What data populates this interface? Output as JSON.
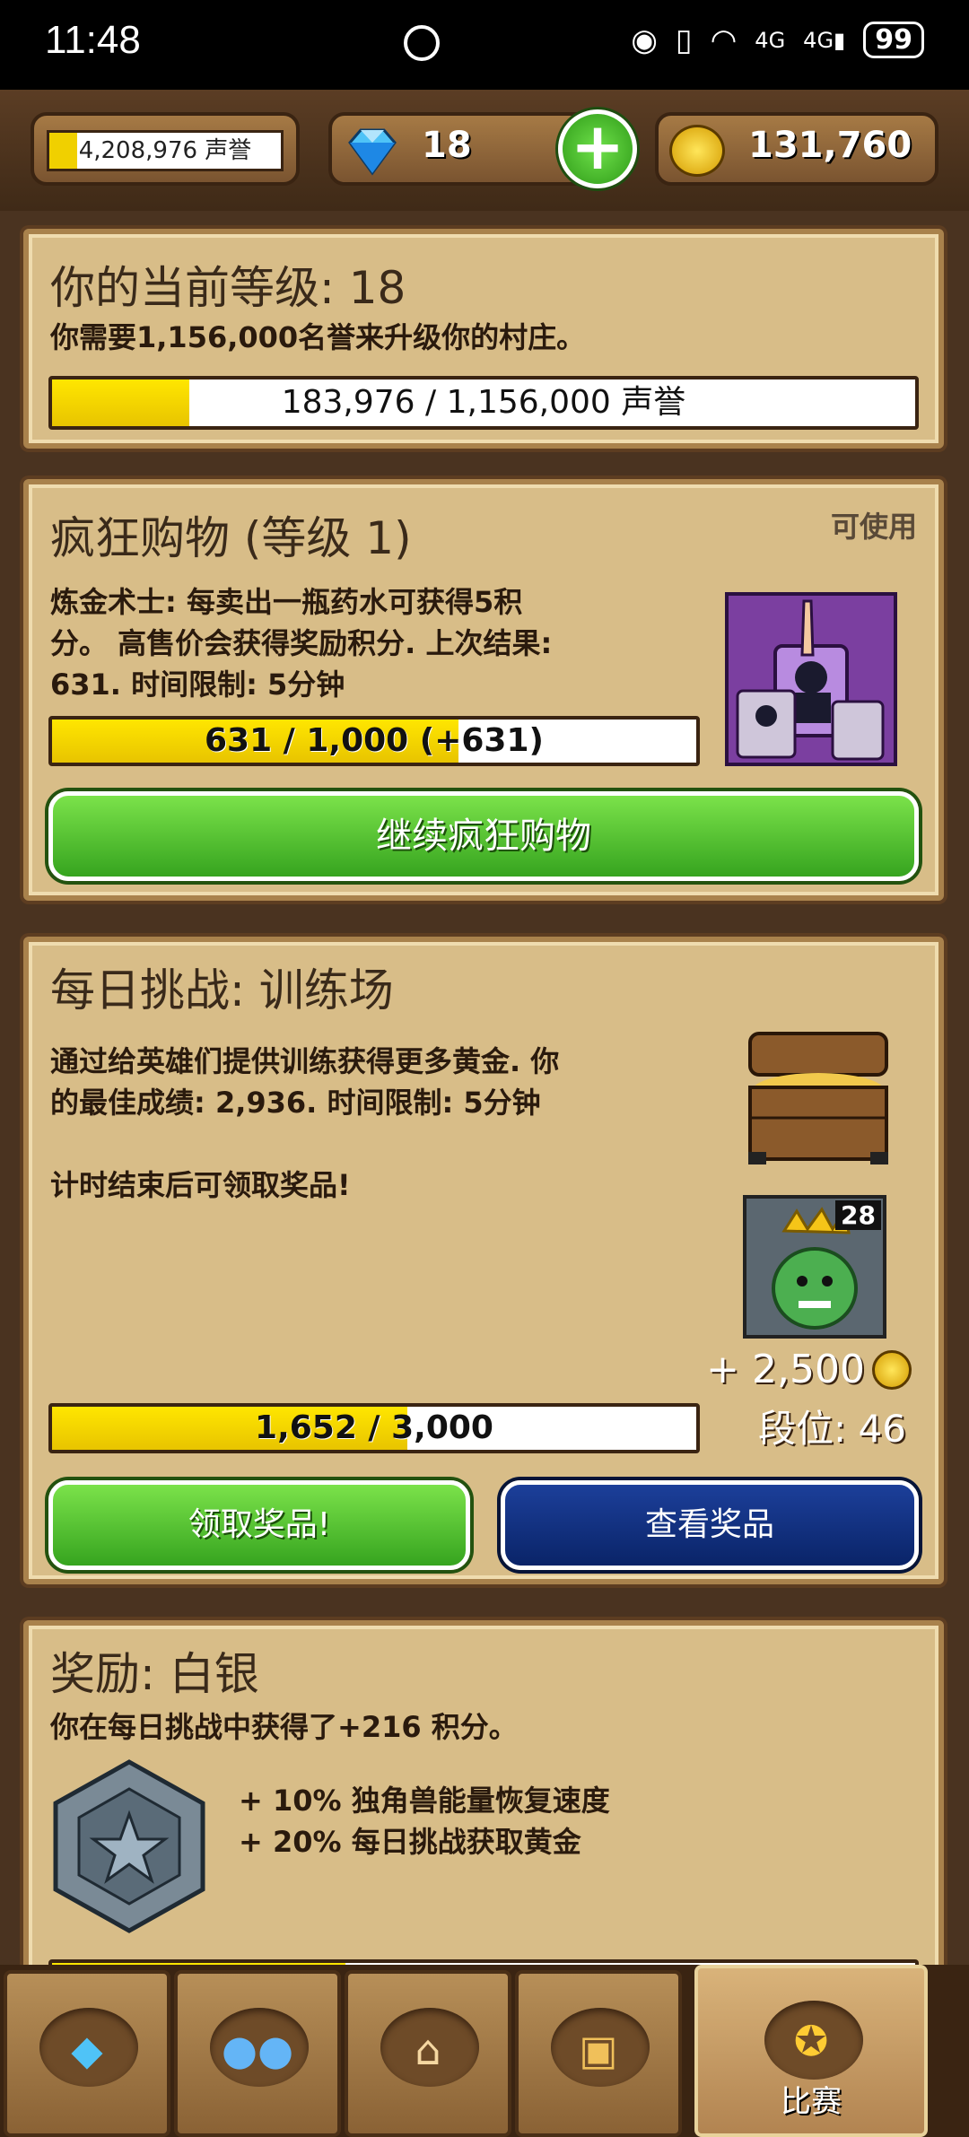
{
  "status_bar": {
    "time": "11:48",
    "network": "4G",
    "battery": "99"
  },
  "top_bar": {
    "fame_value": "4,208,976 声誉",
    "gems": "18",
    "gold": "131,760",
    "plus_label": "+"
  },
  "level_panel": {
    "title": "你的当前等级: 18",
    "description": "你需要1,156,000名誉来升级你的村庄。",
    "progress_label": "183,976 / 1,156,000 声誉",
    "progress_fraction": 0.159
  },
  "shopping_panel": {
    "title": "疯狂购物 (等级 1)",
    "status": "可使用",
    "description": [
      "炼金术士: 每卖出一瓶药水可获得5积",
      "分。 高售价会获得奖励积分. 上次结果:",
      "631. 时间限制: 5分钟"
    ],
    "progress_label": "631 / 1,000 (+631)",
    "progress_fraction": 0.631,
    "button_label": "继续疯狂购物"
  },
  "daily_panel": {
    "title": "每日挑战: 训练场",
    "description": [
      "通过给英雄们提供训练获得更多黄金. 你",
      "的最佳成绩: 2,936. 时间限制: 5分钟"
    ],
    "reward_note": "计时结束后可领取奖品!",
    "hero_level": "28",
    "reward_amount": "+ 2,500",
    "rank_label": "段位: 46",
    "progress_label": "1,652 / 3,000",
    "progress_fraction": 0.551,
    "claim_button": "领取奖品!",
    "view_button": "查看奖品"
  },
  "reward_panel": {
    "title": "奖励: 白银",
    "description": "你在每日挑战中获得了+216 积分。",
    "bonuses": [
      "+ 10% 独角兽能量恢复速度",
      "+ 20% 每日挑战获取黄金"
    ]
  },
  "tab_bar": {
    "items": [
      {
        "icon": "diamond-icon"
      },
      {
        "icon": "heroes-icon"
      },
      {
        "icon": "shop-icon"
      },
      {
        "icon": "chest-icon"
      },
      {
        "icon": "medal-icon",
        "label": "比赛"
      }
    ]
  }
}
